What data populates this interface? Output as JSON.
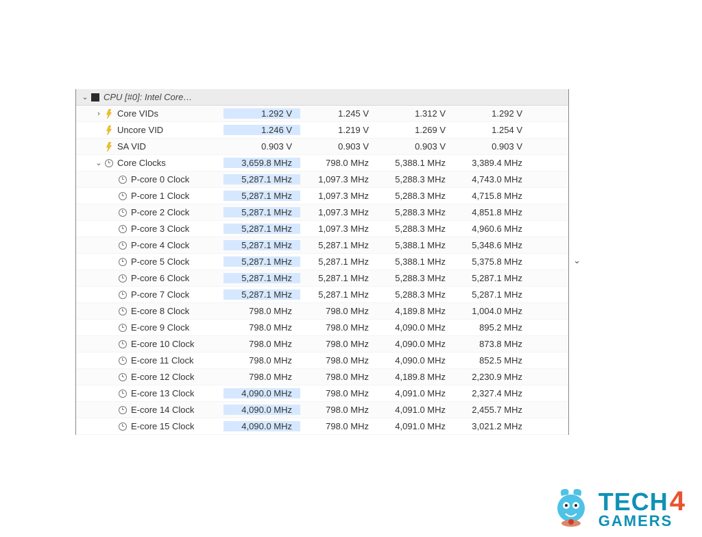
{
  "header": {
    "label": "CPU [#0]: Intel Core…"
  },
  "columns_blank": [
    "",
    "",
    "",
    ""
  ],
  "rows": [
    {
      "name": "core-vids",
      "indent": 1,
      "toggle": "closed",
      "icon": "bolt",
      "label": "Core VIDs",
      "vals": [
        "1.292 V",
        "1.245 V",
        "1.312 V",
        "1.292 V"
      ],
      "hl": [
        0
      ]
    },
    {
      "name": "uncore-vid",
      "indent": 1,
      "toggle": "none",
      "icon": "bolt",
      "label": "Uncore VID",
      "vals": [
        "1.246 V",
        "1.219 V",
        "1.269 V",
        "1.254 V"
      ],
      "hl": [
        0
      ]
    },
    {
      "name": "sa-vid",
      "indent": 1,
      "toggle": "none",
      "icon": "bolt",
      "label": "SA VID",
      "vals": [
        "0.903 V",
        "0.903 V",
        "0.903 V",
        "0.903 V"
      ],
      "hl": []
    },
    {
      "name": "core-clocks",
      "indent": 1,
      "toggle": "open",
      "icon": "clock",
      "label": "Core Clocks",
      "vals": [
        "3,659.8 MHz",
        "798.0 MHz",
        "5,388.1 MHz",
        "3,389.4 MHz"
      ],
      "hl": [
        0
      ]
    },
    {
      "name": "pcore0",
      "indent": 2,
      "toggle": "none",
      "icon": "clock",
      "label": "P-core 0 Clock",
      "vals": [
        "5,287.1 MHz",
        "1,097.3 MHz",
        "5,288.3 MHz",
        "4,743.0 MHz"
      ],
      "hl": [
        0
      ]
    },
    {
      "name": "pcore1",
      "indent": 2,
      "toggle": "none",
      "icon": "clock",
      "label": "P-core 1 Clock",
      "vals": [
        "5,287.1 MHz",
        "1,097.3 MHz",
        "5,288.3 MHz",
        "4,715.8 MHz"
      ],
      "hl": [
        0
      ]
    },
    {
      "name": "pcore2",
      "indent": 2,
      "toggle": "none",
      "icon": "clock",
      "label": "P-core 2 Clock",
      "vals": [
        "5,287.1 MHz",
        "1,097.3 MHz",
        "5,288.3 MHz",
        "4,851.8 MHz"
      ],
      "hl": [
        0
      ]
    },
    {
      "name": "pcore3",
      "indent": 2,
      "toggle": "none",
      "icon": "clock",
      "label": "P-core 3 Clock",
      "vals": [
        "5,287.1 MHz",
        "1,097.3 MHz",
        "5,288.3 MHz",
        "4,960.6 MHz"
      ],
      "hl": [
        0
      ]
    },
    {
      "name": "pcore4",
      "indent": 2,
      "toggle": "none",
      "icon": "clock",
      "label": "P-core 4 Clock",
      "vals": [
        "5,287.1 MHz",
        "5,287.1 MHz",
        "5,388.1 MHz",
        "5,348.6 MHz"
      ],
      "hl": [
        0
      ]
    },
    {
      "name": "pcore5",
      "indent": 2,
      "toggle": "none",
      "icon": "clock",
      "label": "P-core 5 Clock",
      "vals": [
        "5,287.1 MHz",
        "5,287.1 MHz",
        "5,388.1 MHz",
        "5,375.8 MHz"
      ],
      "hl": [
        0
      ]
    },
    {
      "name": "pcore6",
      "indent": 2,
      "toggle": "none",
      "icon": "clock",
      "label": "P-core 6 Clock",
      "vals": [
        "5,287.1 MHz",
        "5,287.1 MHz",
        "5,288.3 MHz",
        "5,287.1 MHz"
      ],
      "hl": [
        0
      ]
    },
    {
      "name": "pcore7",
      "indent": 2,
      "toggle": "none",
      "icon": "clock",
      "label": "P-core 7 Clock",
      "vals": [
        "5,287.1 MHz",
        "5,287.1 MHz",
        "5,288.3 MHz",
        "5,287.1 MHz"
      ],
      "hl": [
        0
      ]
    },
    {
      "name": "ecore8",
      "indent": 2,
      "toggle": "none",
      "icon": "clock",
      "label": "E-core 8 Clock",
      "vals": [
        "798.0 MHz",
        "798.0 MHz",
        "4,189.8 MHz",
        "1,004.0 MHz"
      ],
      "hl": []
    },
    {
      "name": "ecore9",
      "indent": 2,
      "toggle": "none",
      "icon": "clock",
      "label": "E-core 9 Clock",
      "vals": [
        "798.0 MHz",
        "798.0 MHz",
        "4,090.0 MHz",
        "895.2 MHz"
      ],
      "hl": []
    },
    {
      "name": "ecore10",
      "indent": 2,
      "toggle": "none",
      "icon": "clock",
      "label": "E-core 10 Clock",
      "vals": [
        "798.0 MHz",
        "798.0 MHz",
        "4,090.0 MHz",
        "873.8 MHz"
      ],
      "hl": []
    },
    {
      "name": "ecore11",
      "indent": 2,
      "toggle": "none",
      "icon": "clock",
      "label": "E-core 11 Clock",
      "vals": [
        "798.0 MHz",
        "798.0 MHz",
        "4,090.0 MHz",
        "852.5 MHz"
      ],
      "hl": []
    },
    {
      "name": "ecore12",
      "indent": 2,
      "toggle": "none",
      "icon": "clock",
      "label": "E-core 12 Clock",
      "vals": [
        "798.0 MHz",
        "798.0 MHz",
        "4,189.8 MHz",
        "2,230.9 MHz"
      ],
      "hl": []
    },
    {
      "name": "ecore13",
      "indent": 2,
      "toggle": "none",
      "icon": "clock",
      "label": "E-core 13 Clock",
      "vals": [
        "4,090.0 MHz",
        "798.0 MHz",
        "4,091.0 MHz",
        "2,327.4 MHz"
      ],
      "hl": [
        0
      ]
    },
    {
      "name": "ecore14",
      "indent": 2,
      "toggle": "none",
      "icon": "clock",
      "label": "E-core 14 Clock",
      "vals": [
        "4,090.0 MHz",
        "798.0 MHz",
        "4,091.0 MHz",
        "2,455.7 MHz"
      ],
      "hl": [
        0
      ]
    },
    {
      "name": "ecore15",
      "indent": 2,
      "toggle": "none",
      "icon": "clock",
      "label": "E-core 15 Clock",
      "vals": [
        "4,090.0 MHz",
        "798.0 MHz",
        "4,091.0 MHz",
        "3,021.2 MHz"
      ],
      "hl": [
        0
      ]
    }
  ],
  "watermark": {
    "brand_a": "TECH",
    "brand_b": "4",
    "brand_c": "GAMERS"
  }
}
